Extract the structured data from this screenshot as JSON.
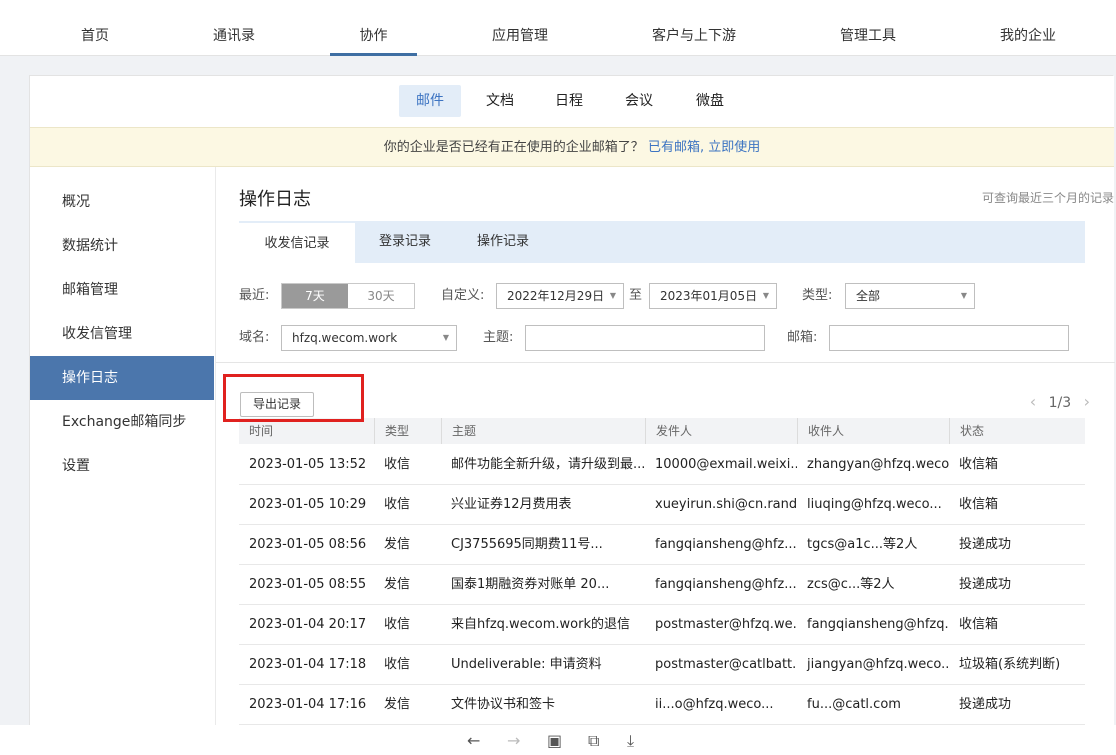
{
  "topnav": [
    "首页",
    "通讯录",
    "协作",
    "应用管理",
    "客户与上下游",
    "管理工具",
    "我的企业"
  ],
  "subnav": [
    "邮件",
    "文档",
    "日程",
    "会议",
    "微盘"
  ],
  "banner": {
    "text": "你的企业是否已经有正在使用的企业邮箱了？",
    "link": "已有邮箱, 立即使用"
  },
  "sidebar": [
    "概况",
    "数据统计",
    "邮箱管理",
    "收发信管理",
    "操作日志",
    "Exchange邮箱同步",
    "设置"
  ],
  "page": {
    "title": "操作日志",
    "note": "可查询最近三个月的记录"
  },
  "tabs": [
    "收发信记录",
    "登录记录",
    "操作记录"
  ],
  "filters": {
    "recent_label": "最近:",
    "recent_7": "7天",
    "recent_30": "30天",
    "custom_label": "自定义:",
    "date_from": "2022年12月29日",
    "to": "至",
    "date_to": "2023年01月05日",
    "type_label": "类型:",
    "type_value": "全部",
    "domain_label": "域名:",
    "domain_value": "hfzq.wecom.work",
    "subject_label": "主题:",
    "mailbox_label": "邮箱:"
  },
  "export_label": "导出记录",
  "pager": "1/3",
  "columns": [
    "时间",
    "类型",
    "主题",
    "发件人",
    "收件人",
    "状态"
  ],
  "rows": [
    [
      "2023-01-05 13:52",
      "收信",
      "邮件功能全新升级，请升级到最...",
      "10000@exmail.weixi...",
      "zhangyan@hfzq.weco...",
      "收信箱"
    ],
    [
      "2023-01-05 10:29",
      "收信",
      "兴业证券12月费用表",
      "xueyirun.shi@cn.rand...",
      "liuqing@hfzq.weco...",
      "收信箱"
    ],
    [
      "2023-01-05 08:56",
      "发信",
      "CJ3755695同期费11号...",
      "fangqiansheng@hfz...",
      "tgcs@a1c...等2人",
      "投递成功"
    ],
    [
      "2023-01-05 08:55",
      "发信",
      "国泰1期融资券对账单 20...",
      "fangqiansheng@hfz...",
      "zcs@c...等2人",
      "投递成功"
    ],
    [
      "2023-01-04 20:17",
      "收信",
      "来自hfzq.wecom.work的退信",
      "postmaster@hfzq.we...",
      "fangqiansheng@hfzq.w...",
      "收信箱"
    ],
    [
      "2023-01-04 17:18",
      "收信",
      "Undeliverable: 申请资料",
      "postmaster@catlbatt...",
      "jiangyan@hfzq.weco...",
      "垃圾箱(系统判断)"
    ],
    [
      "2023-01-04 17:16",
      "发信",
      "文件协议书和签卡",
      "ii...o@hfzq.weco...",
      "fu...@catl.com",
      "投递成功"
    ]
  ],
  "bottom_icons": [
    "back-arrow-icon",
    "forward-arrow-icon",
    "window-icon",
    "share-icon",
    "download-icon"
  ]
}
